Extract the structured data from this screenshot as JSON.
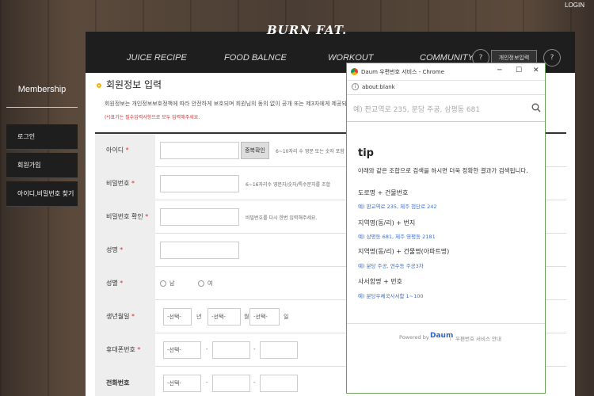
{
  "header": {
    "login": "LOGIN",
    "logo": "BURN FAT."
  },
  "nav": {
    "items": [
      "JUICE RECIPE",
      "FOOD BALNCE",
      "WORKOUT",
      "COMMUNITY"
    ],
    "btn1": "?",
    "search": "개인정보입력",
    "btn2": "?"
  },
  "sidebar": {
    "title": "Membership",
    "items": [
      {
        "label": "로그인"
      },
      {
        "label": "회원가입"
      },
      {
        "label": "아이디,비밀번호 찾기"
      }
    ]
  },
  "form": {
    "title": "회원정보 입력",
    "desc": "회원정보는 개인정보보호정책에 따라 안전하게 보호되며 회원님의 동의 없이 공개 또는 제3자에게 제공되지 않습니다.",
    "req_note": "(*)표기는 필수입력사항으로 모두 입력해주세요.",
    "rows": {
      "id": {
        "label": "아이디",
        "req": "*",
        "btn": "중복확인",
        "hint": "6~10자리 수 영문 또는 숫자 포함 가능"
      },
      "pw": {
        "label": "비밀번호",
        "req": "*",
        "hint": "6~16자리수 영문자/숫자/특수문자를 조합"
      },
      "pw2": {
        "label": "비밀번호 확인",
        "req": "*",
        "hint": "비밀번호를 다시 한번 입력해주세요."
      },
      "name": {
        "label": "성명",
        "req": "*"
      },
      "gender": {
        "label": "성별",
        "req": "*",
        "opt1": "남",
        "opt2": "여"
      },
      "birth": {
        "label": "생년월일",
        "req": "*",
        "sel": "-선택-",
        "y": "년",
        "m": "월",
        "d": "일"
      },
      "mobile": {
        "label": "휴대폰번호",
        "req": "*",
        "sel": "-선택-",
        "dash": "-"
      },
      "phone": {
        "label": "전화번호",
        "sel": "-선택-",
        "dash": "-"
      }
    }
  },
  "popup": {
    "title": "Daum 우편번호 서비스 - Chrome",
    "url": "about:blank",
    "min": "─",
    "max": "☐",
    "close": "✕",
    "addr_icon": "i",
    "search_placeholder": "예) 판교역로 235, 분당 주공, 삼평동 681",
    "tip_title": "tip",
    "tip_desc": "아래와 같은 조합으로 검색을 하시면 더욱 정확한 결과가 검색됩니다.",
    "tips": [
      {
        "h": "도로명 + 건물번호",
        "ex": "예) 판교역로 235,  제주 첨단로 242"
      },
      {
        "h": "지역명(동/리) + 번지",
        "ex": "예) 삼평동 681,  제주 영평동 2181"
      },
      {
        "h": "지역명(동/리) + 건물명(아파트명)",
        "ex": "예) 분당 주공,  연수동 주공3차"
      },
      {
        "h": "사서함명 + 번호",
        "ex": "예) 분당우체국사서함 1~100"
      }
    ],
    "powered": "Powered by",
    "daum": "Daum",
    "guide": "우편번호 서비스 안내"
  }
}
